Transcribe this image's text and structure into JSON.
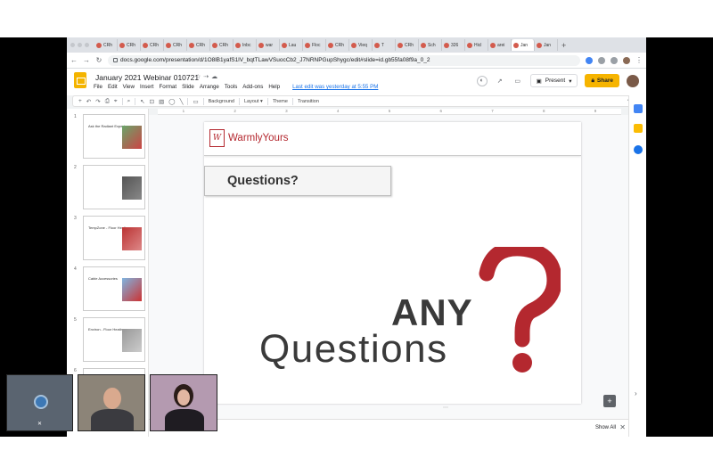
{
  "browser": {
    "tabs": [
      "CRh",
      "CRh",
      "CRh",
      "CRh",
      "CRh",
      "CRh",
      "Inbc",
      "war",
      "Lau",
      "Floc",
      "CRh",
      "Vieq",
      "T",
      "CRh",
      "Sch",
      "326",
      "Hicl",
      "arei",
      "Jan",
      "Jan"
    ],
    "url": "docs.google.com/presentation/d/1O8lB1yafS1lV_bqtTLawVSuocCb2_J7NRNPGupShygc/edit#slide=id.gb55fa08f9a_0_2"
  },
  "docs": {
    "title": "January 2021 Webinar 010721",
    "menu": [
      "File",
      "Edit",
      "View",
      "Insert",
      "Format",
      "Slide",
      "Arrange",
      "Tools",
      "Add-ons",
      "Help"
    ],
    "last_edit": "Last edit was yesterday at 5:55 PM",
    "present_label": "Present",
    "share_label": "Share"
  },
  "toolbar": {
    "background": "Background",
    "layout": "Layout",
    "theme": "Theme",
    "transition": "Transition"
  },
  "ruler": [
    "1",
    "2",
    "3",
    "4",
    "5",
    "6",
    "7",
    "8",
    "9"
  ],
  "thumbnails": [
    {
      "num": "1",
      "title": "Ask the Radiant Experts",
      "body": ""
    },
    {
      "num": "2",
      "title": "",
      "body": ""
    },
    {
      "num": "3",
      "title": "TempZone - Floor Heating",
      "body": ""
    },
    {
      "num": "4",
      "title": "Cable Accessories",
      "body": ""
    },
    {
      "num": "5",
      "title": "Environ - Floor Heating",
      "body": ""
    },
    {
      "num": "6",
      "title": "",
      "body": ""
    }
  ],
  "slide": {
    "brand_mark": "W",
    "brand_name": "WarmlyYours",
    "questions_title": "Questions?",
    "any_word": "ANY",
    "questions_word": "Questions"
  },
  "bottom": {
    "show_all": "Show All"
  },
  "colors": {
    "brand_red": "#b4282f",
    "share_yellow": "#f6b400"
  }
}
